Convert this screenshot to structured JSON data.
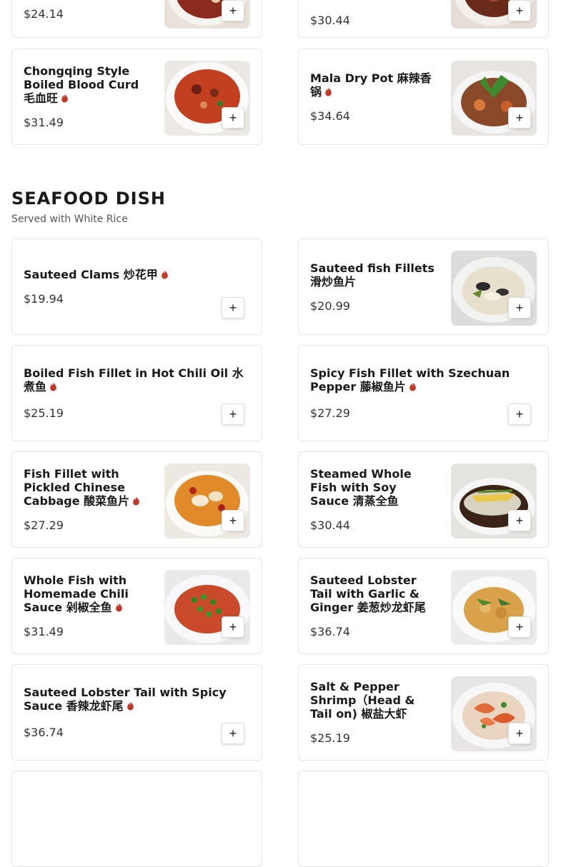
{
  "colors": {
    "accent_red": "#c0392b",
    "border": "#e4e4e4"
  },
  "top_items": [
    {
      "name": "",
      "price": "$24.14",
      "spicy": false,
      "image": "dish-photo"
    },
    {
      "name": "",
      "price": "$30.44",
      "spicy": false,
      "image": "dish-photo"
    },
    {
      "name": "Chongqing Style Boiled Blood Curd 毛血旺",
      "price": "$31.49",
      "spicy": true,
      "image": "dish-photo"
    },
    {
      "name": "Mala Dry Pot 麻辣香锅",
      "price": "$34.64",
      "spicy": true,
      "image": "dish-photo"
    }
  ],
  "section": {
    "title": "SEAFOOD DISH",
    "subtitle": "Served with White Rice",
    "items": [
      {
        "name": "Sauteed Clams 炒花甲",
        "price": "$19.94",
        "spicy": true
      },
      {
        "name": "Sauteed fish Fillets 滑炒鱼片",
        "price": "$20.99",
        "spicy": false,
        "image": "dish-photo"
      },
      {
        "name": "Boiled Fish Fillet in Hot Chili Oil 水煮鱼",
        "price": "$25.19",
        "spicy": true
      },
      {
        "name": "Spicy Fish Fillet with Szechuan Pepper 藤椒鱼片",
        "price": "$27.29",
        "spicy": true
      },
      {
        "name": "Fish Fillet with Pickled Chinese Cabbage 酸菜鱼片",
        "price": "$27.29",
        "spicy": true,
        "image": "dish-photo"
      },
      {
        "name": "Steamed Whole Fish with Soy Sauce 清蒸全鱼",
        "price": "$30.44",
        "spicy": false,
        "image": "dish-photo"
      },
      {
        "name": "Whole Fish with Homemade Chili Sauce 剁椒全鱼",
        "price": "$31.49",
        "spicy": true,
        "image": "dish-photo"
      },
      {
        "name": "Sauteed Lobster Tail with Garlic & Ginger 姜葱炒龙虾尾",
        "price": "$36.74",
        "spicy": false,
        "image": "dish-photo"
      },
      {
        "name": "Sauteed Lobster Tail with Spicy Sauce 香辣龙虾尾",
        "price": "$36.74",
        "spicy": true
      },
      {
        "name": "Salt & Pepper Shrimp（Head & Tail on) 椒盐大虾",
        "price": "$25.19",
        "spicy": false,
        "image": "dish-photo"
      }
    ]
  },
  "add_label": "+"
}
